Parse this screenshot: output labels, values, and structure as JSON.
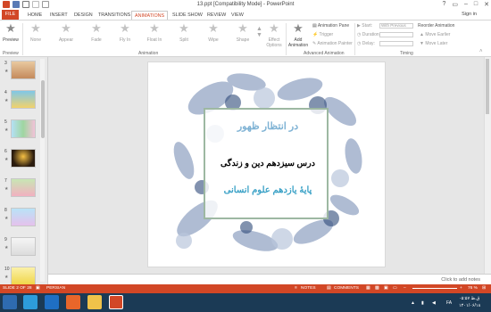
{
  "window": {
    "title": "13.ppt [Compatibility Mode] - PowerPoint",
    "sign_in": "Sign in"
  },
  "tabs": [
    {
      "label": "FILE"
    },
    {
      "label": "HOME"
    },
    {
      "label": "INSERT"
    },
    {
      "label": "DESIGN"
    },
    {
      "label": "TRANSITIONS"
    },
    {
      "label": "ANIMATIONS"
    },
    {
      "label": "SLIDE SHOW"
    },
    {
      "label": "REVIEW"
    },
    {
      "label": "VIEW"
    }
  ],
  "ribbon": {
    "preview": "Preview",
    "animations": [
      "None",
      "Appear",
      "Fade",
      "Fly In",
      "Float In",
      "Split",
      "Wipe",
      "Shape"
    ],
    "effect_options": "Effect Options",
    "add_animation": "Add Animation",
    "animation_pane": "Animation Pane",
    "trigger": "Trigger",
    "animation_painter": "Animation Painter",
    "start": "Start:",
    "start_value": "With Previous",
    "duration": "Duration:",
    "delay": "Delay:",
    "reorder": "Reorder Animation",
    "move_earlier": "Move Earlier",
    "move_later": "Move Later",
    "groups": {
      "preview": "Preview",
      "animation": "Animation",
      "advanced": "Advanced Animation",
      "timing": "Timing"
    }
  },
  "thumbnails": [
    {
      "num": "3"
    },
    {
      "num": "4"
    },
    {
      "num": "5"
    },
    {
      "num": "6"
    },
    {
      "num": "7"
    },
    {
      "num": "8"
    },
    {
      "num": "9"
    },
    {
      "num": "10"
    }
  ],
  "slide": {
    "line1": "در انتظار ظهور",
    "line2": "درس سیزدهم دین و زندگی",
    "line3": "پایۀ یازدهم علوم انسانی"
  },
  "notes_placeholder": "Click to add notes",
  "status": {
    "slide": "SLIDE 2 OF 28",
    "language": "PERSIAN",
    "notes": "NOTES",
    "comments": "COMMENTS",
    "zoom": "76 %"
  },
  "tray": {
    "lang": "FA",
    "time": "۰۵:۵۷ ق.ظ",
    "date": "۱۴۰۱/۰۶/۱۸"
  },
  "colors": {
    "accent": "#d24726",
    "taskbar": "#1b3a55"
  }
}
